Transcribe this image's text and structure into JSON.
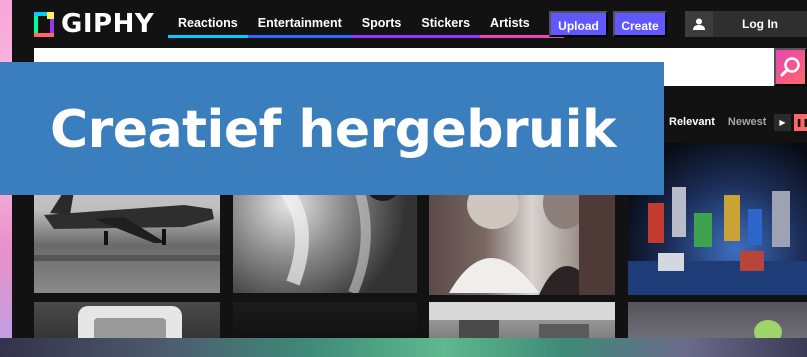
{
  "brand": {
    "name": "GIPHY"
  },
  "nav": {
    "items": [
      {
        "label": "Reactions",
        "color": "#00ccff"
      },
      {
        "label": "Entertainment",
        "color": "#3366ff"
      },
      {
        "label": "Sports",
        "color": "#9933ff"
      },
      {
        "label": "Stickers",
        "color": "#9933ff"
      },
      {
        "label": "Artists",
        "color": "#e646b6"
      }
    ],
    "more_icon": "more-vertical-icon"
  },
  "actions": {
    "upload_label": "Upload",
    "create_label": "Create",
    "login_label": "Log In"
  },
  "search": {
    "icon": "search-icon"
  },
  "results": {
    "sort_options": [
      "Relevant",
      "Newest"
    ],
    "active_sort": "Relevant",
    "view_toggle": [
      "play-icon",
      "pause-icon"
    ]
  },
  "gifs": [
    "airplane-gif",
    "abstract-gif",
    "saint-nicholas-gif",
    "robots-gif",
    "phone-gif",
    "dark-gif",
    "street-gif",
    "toy-gif"
  ],
  "banner": {
    "title": "Creatief hergebruik"
  },
  "colors": {
    "accent": "#6157ff",
    "banner": "#3b7ebd",
    "search_gradient": [
      "#e646b6",
      "#ff6666"
    ]
  }
}
